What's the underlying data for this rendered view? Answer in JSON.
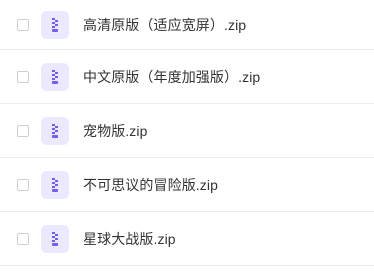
{
  "files": [
    {
      "name": "高清原版（适应宽屏）.zip",
      "icon": "zip-file-icon"
    },
    {
      "name": "中文原版（年度加强版）.zip",
      "icon": "zip-file-icon"
    },
    {
      "name": "宠物版.zip",
      "icon": "zip-file-icon"
    },
    {
      "name": "不可思议的冒险版.zip",
      "icon": "zip-file-icon"
    },
    {
      "name": "星球大战版.zip",
      "icon": "zip-file-icon"
    }
  ],
  "colors": {
    "icon_bg": "#ebe9ff",
    "icon_fg": "#6f5ef9",
    "text": "#333333",
    "divider": "#ececec"
  }
}
